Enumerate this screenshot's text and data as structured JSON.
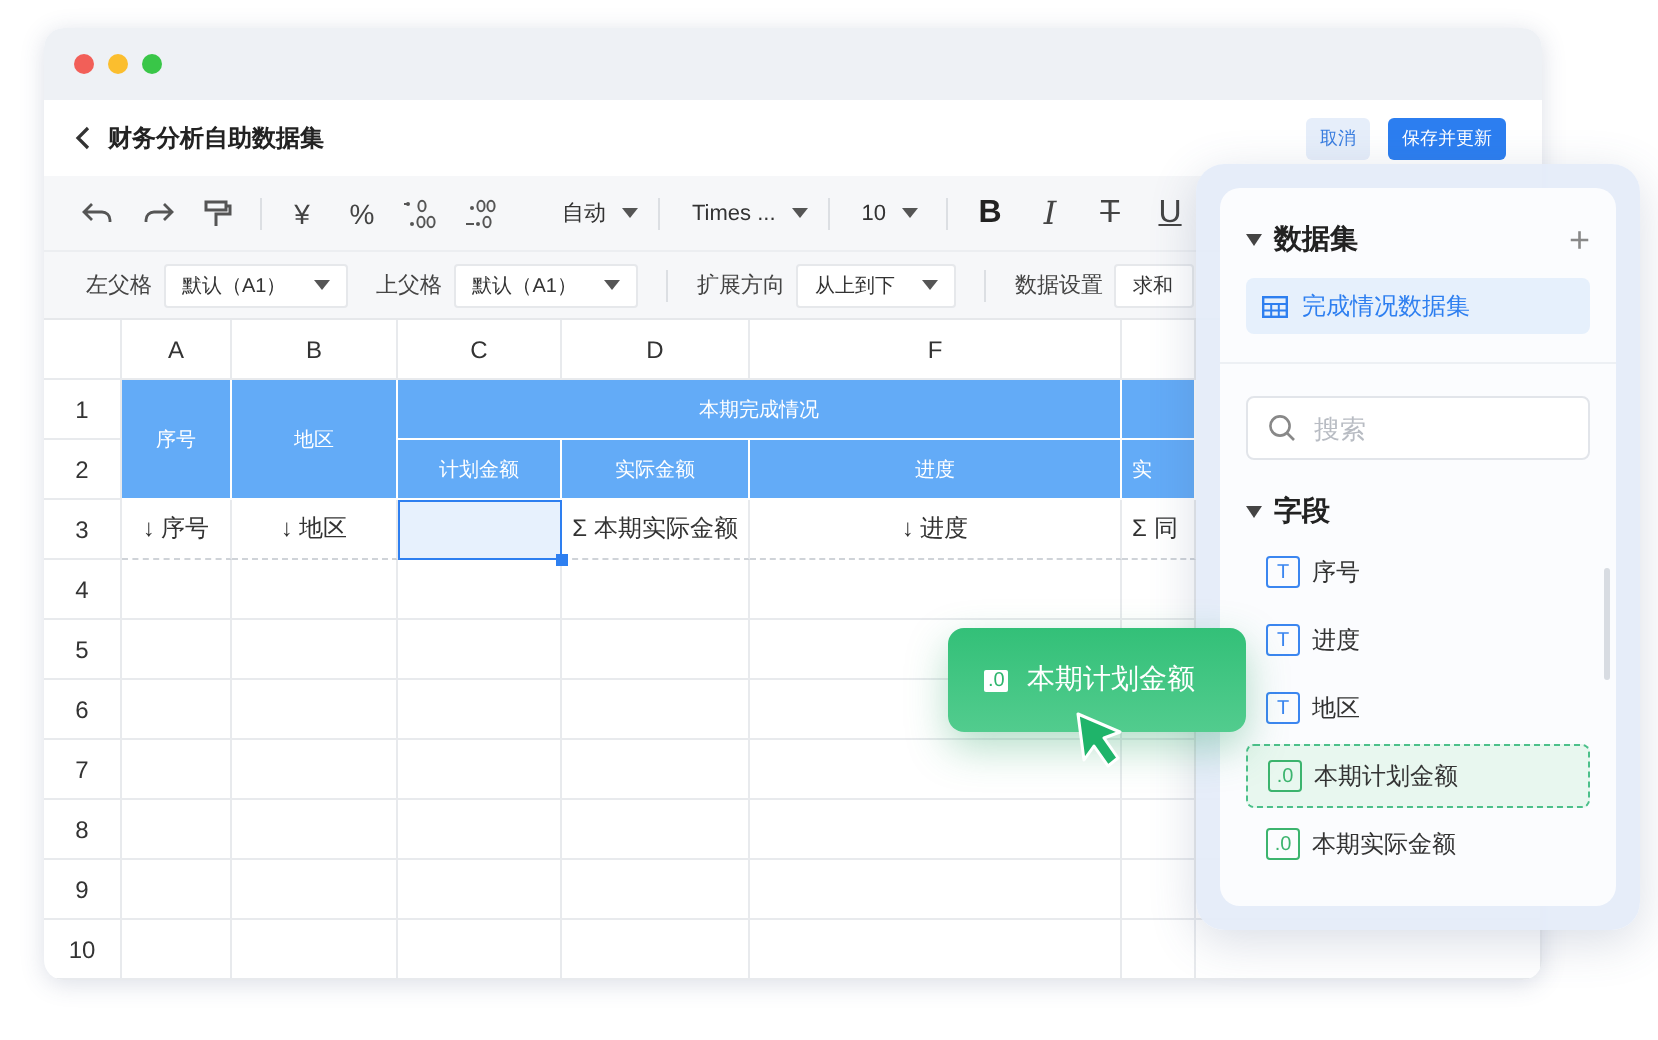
{
  "page": {
    "title": "财务分析自助数据集",
    "buttons": [
      {
        "label": "取消",
        "kind": "secondary"
      },
      {
        "label": "保存并更新",
        "kind": "primary"
      }
    ]
  },
  "toolbar": {
    "currency": "¥",
    "percent": "%",
    "format": "自动",
    "font": "Times ...",
    "size": "10",
    "styles": [
      {
        "label": "B",
        "kind": "bold"
      },
      {
        "label": "I",
        "kind": "italic"
      },
      {
        "label": "T",
        "kind": "strike"
      },
      {
        "label": "U",
        "kind": "underline"
      }
    ]
  },
  "properties": [
    {
      "label": "左父格",
      "value": "默认（A1）",
      "dropdown": true
    },
    {
      "label": "上父格",
      "value": "默认（A1）",
      "dropdown": true
    },
    {
      "label": "扩展方向",
      "value": "从上到下",
      "dropdown": true
    },
    {
      "label": "数据设置",
      "value": "求和",
      "dropdown": false
    }
  ],
  "sheet": {
    "column_letters": [
      "A",
      "B",
      "C",
      "D",
      "F"
    ],
    "row_numbers": [
      "1",
      "2",
      "3",
      "4",
      "5",
      "6",
      "7",
      "8",
      "9",
      "10"
    ],
    "fields": [
      "序号",
      "地区"
    ],
    "groups": [
      {
        "title": "本期完成情况",
        "columns": [
          "计划金额",
          "实际金额",
          "进度"
        ]
      },
      {
        "columns": [
          "实"
        ]
      }
    ],
    "data_row": [
      {
        "text": "↓ 序号",
        "selected": false
      },
      {
        "text": "↓ 地区",
        "selected": false
      },
      {
        "selected": true
      },
      {
        "text": "Σ 本期实际金额",
        "selected": false
      },
      {
        "text": "↓ 进度",
        "selected": false
      },
      {
        "text": "Σ 同",
        "selected": false
      }
    ]
  },
  "panel": {
    "dataset_title": "数据集",
    "add": "+",
    "datasets": [
      {
        "label": "完成情况数据集",
        "selected": true
      }
    ],
    "search": {
      "placeholder": "搜索"
    },
    "fields_title": "字段",
    "fields": [
      {
        "badge": "T",
        "label": "序号",
        "kind": "text",
        "drop_target": false
      },
      {
        "badge": "T",
        "label": "进度",
        "kind": "text",
        "drop_target": false
      },
      {
        "badge": "T",
        "label": "地区",
        "kind": "text",
        "drop_target": false
      },
      {
        "badge": ".0",
        "label": "本期计划金额",
        "kind": "number",
        "drop_target": true
      },
      {
        "badge": ".0",
        "label": "本期实际金额",
        "kind": "number",
        "drop_target": false
      }
    ]
  },
  "drag_chip": {
    "badge": ".0",
    "label": "本期计划金额"
  }
}
